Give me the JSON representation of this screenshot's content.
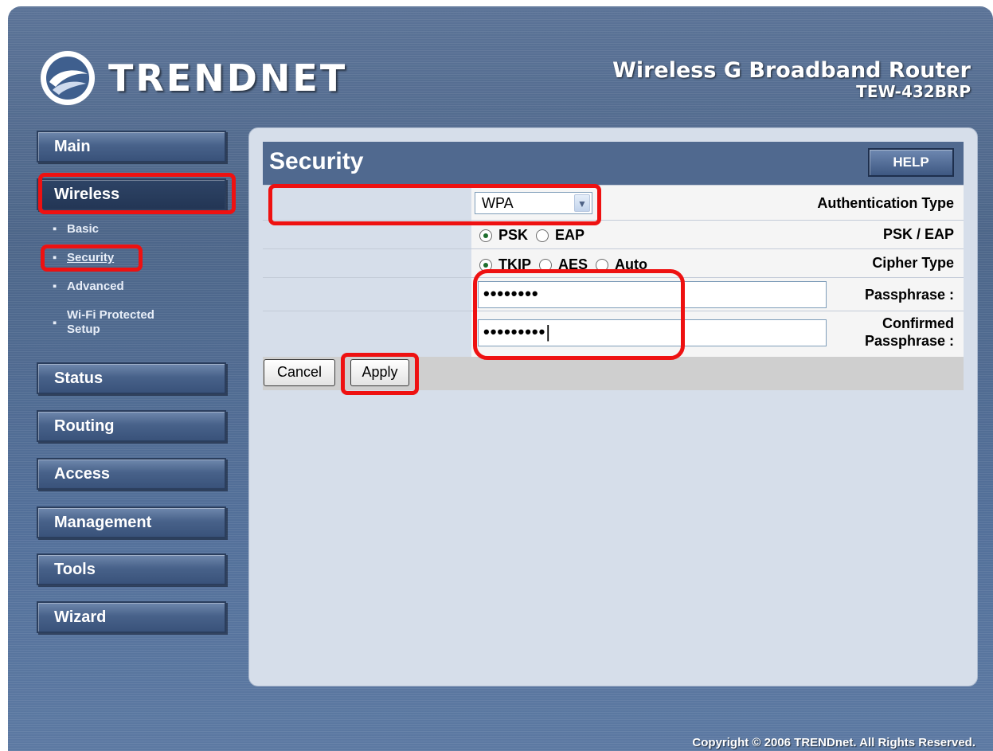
{
  "brand": {
    "logo_text": "TRENDNET"
  },
  "product": {
    "name": "Wireless G Broadband Router",
    "model": "TEW-432BRP"
  },
  "nav": {
    "main": "Main",
    "wireless": "Wireless",
    "wireless_sub": {
      "basic": "Basic",
      "security": "Security",
      "advanced": "Advanced",
      "wps_line1": "Wi-Fi Protected",
      "wps_line2": "Setup"
    },
    "status": "Status",
    "routing": "Routing",
    "access": "Access",
    "management": "Management",
    "tools": "Tools",
    "wizard": "Wizard"
  },
  "page": {
    "title": "Security",
    "help_label": "HELP",
    "auth_type_label": "Authentication Type",
    "auth_type_value": "WPA",
    "psk_eap_label": "PSK / EAP",
    "psk_option": "PSK",
    "eap_option": "EAP",
    "psk_eap_selected": "PSK",
    "cipher_label": "Cipher Type",
    "cipher_tkip": "TKIP",
    "cipher_aes": "AES",
    "cipher_auto": "Auto",
    "cipher_selected": "TKIP",
    "passphrase_label": "Passphrase :",
    "passphrase_value": "••••••••",
    "confirm_label_line1": "Confirmed",
    "confirm_label_line2": "Passphrase :",
    "confirm_value": "•••••••••",
    "cancel_label": "Cancel",
    "apply_label": "Apply"
  },
  "footer": {
    "copyright": "Copyright © 2006 TRENDnet. All Rights Reserved."
  },
  "colors": {
    "annotation": "#ee1111",
    "nav_bg": "#48628a",
    "title_bar": "#50698f"
  }
}
